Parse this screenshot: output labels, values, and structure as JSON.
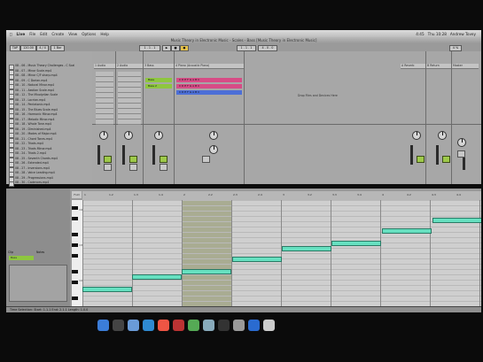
{
  "menubar": {
    "apple": "",
    "items": [
      "Live",
      "File",
      "Edit",
      "Create",
      "View",
      "Options",
      "Help"
    ],
    "right": [
      "4:45",
      "Thu 10:28",
      "Andrew Tovey"
    ]
  },
  "window_title": "Music Theory in Electronic Music - Scales - Bass  [Music Theory in Electronic Music]",
  "toolbar": {
    "tempo": "120.00",
    "sig": "4 / 4",
    "position": "1 . 1 . 1",
    "quant": "1 Bar",
    "loop": "1 . 1 . 1",
    "length": "4 . 0 . 0",
    "cpu": "4 %"
  },
  "browser": {
    "items": [
      "08 - 06 - Music Theory Challenges - C Scal",
      "08 - 07 - Minor Scale.mp4",
      "08 - 08 - Minor C/F sharp.mp4",
      "08 - 09 - C Dorian.mp4",
      "08 - 10 - Natural Minor.mp4",
      "08 - 11 - Aeolian Scale.mp4",
      "08 - 12 - The Mixolydian Scale",
      "08 - 13 - Locrian.mp4",
      "08 - 14 - Pentatonic.mp4",
      "08 - 15 - The Blues Scale.mp4",
      "08 - 16 - Harmonic Minor.mp4",
      "08 - 17 - Melodic Minor.mp4",
      "08 - 18 - Whole Tone.mp4",
      "08 - 19 - Diminished.mp4",
      "08 - 20 - Modes of Major.mp4",
      "08 - 21 - Chord Tones.mp4",
      "08 - 22 - Triads.mp4",
      "08 - 23 - Triads Minor.mp4",
      "08 - 24 - Triads 2.mp4",
      "08 - 25 - Seventh Chords.mp4",
      "08 - 26 - Extended.mp4",
      "08 - 27 - Inversions.mp4",
      "08 - 28 - Voice Leading.mp4",
      "08 - 29 - Progressions.mp4",
      "08 - 30 - Cadences.mp4"
    ]
  },
  "tracks": [
    {
      "name": "1 Audio"
    },
    {
      "name": "2 Audio"
    },
    {
      "name": "3 Bass"
    },
    {
      "name": "4 Piano (Acoustic Piano)"
    },
    {
      "name": "A Reverb"
    },
    {
      "name": "B Return"
    },
    {
      "name": "Master"
    }
  ],
  "clips": {
    "bass_1": "Bass",
    "bass_2": "Bass 2",
    "piano_1": "C  D  E  F  G  A  B  C",
    "piano_2": "C  D  E  F  G  A  B  C",
    "piano_3": "C  D  E  F  G  A  B  C",
    "drop_hint": "Drop Files and Devices Here"
  },
  "colors": {
    "note_fill": "#66e0c0",
    "clip_pink": "#d74c86",
    "clip_blue": "#4c6fd7",
    "clip_green": "#8ec63f"
  },
  "pianoroll": {
    "ruler": [
      "1",
      "1.2",
      "1.3",
      "1.4",
      "2",
      "2.2",
      "2.3",
      "2.4",
      "3",
      "3.2",
      "3.3",
      "3.4",
      "4",
      "4.2",
      "4.3",
      "4.4"
    ],
    "keys": [
      "C4",
      "C3",
      "C2"
    ],
    "fold": "Fold",
    "clip_label": "Clip",
    "notes_label": "Notes",
    "clip_name": "Bass"
  },
  "status": {
    "text": "Time Selection:  Start: 1.1.1   End: 2.1.1   Length: 1.0.0",
    "right": "Bass"
  },
  "dock_icons": [
    "finder-icon",
    "dashboard-icon",
    "mail-icon",
    "safari-icon",
    "calendar-icon",
    "itunes-icon",
    "photos-icon",
    "preview-icon",
    "ableton-icon",
    "system-prefs-icon",
    "app-store-icon",
    "trash-icon"
  ]
}
